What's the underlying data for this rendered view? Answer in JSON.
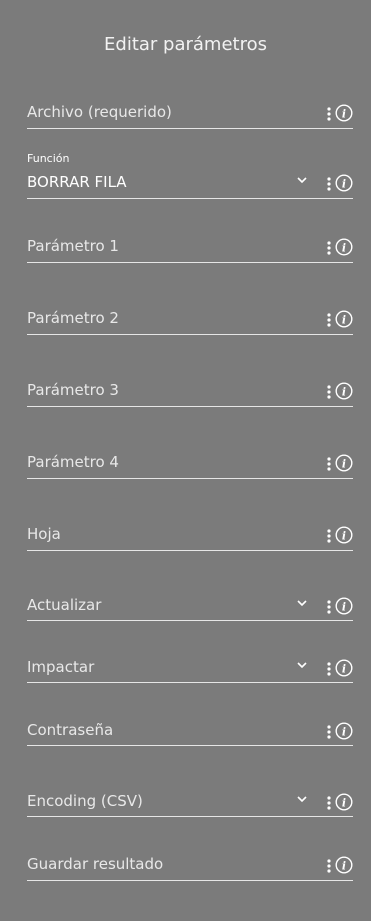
{
  "header": {
    "title": "Editar parámetros"
  },
  "fields": [
    {
      "label": "Archivo (requerido)",
      "dropdown": false
    },
    {
      "label": "BORRAR FILA",
      "caption": "Función",
      "dropdown": true
    },
    {
      "label": "Parámetro 1",
      "dropdown": false
    },
    {
      "label": "Parámetro 2",
      "dropdown": false
    },
    {
      "label": "Parámetro 3",
      "dropdown": false
    },
    {
      "label": "Parámetro 4",
      "dropdown": false
    },
    {
      "label": "Hoja",
      "dropdown": false
    },
    {
      "label": "Actualizar",
      "dropdown": true
    },
    {
      "label": "Impactar",
      "dropdown": true
    },
    {
      "label": "Contraseña",
      "dropdown": false
    },
    {
      "label": "Encoding (CSV)",
      "dropdown": true
    },
    {
      "label": "Guardar resultado",
      "dropdown": false
    }
  ],
  "icons": {
    "more": "more-vertical-icon",
    "info": "info-icon",
    "dropdown": "chevron-down-icon"
  },
  "colors": {
    "panel_background": "#7b7b7b",
    "text": "#ffffff",
    "underline": "#e6e6e6"
  }
}
